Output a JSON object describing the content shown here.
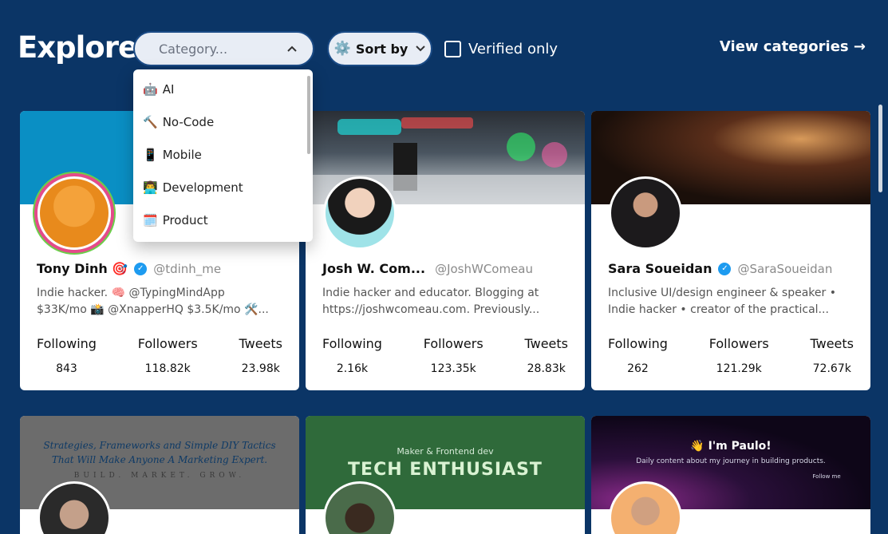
{
  "header": {
    "title": "Explore",
    "category_placeholder": "Category...",
    "sort_label": "Sort by",
    "verified_label": "Verified only",
    "view_categories": "View categories →"
  },
  "dropdown": {
    "items": [
      {
        "icon": "🤖",
        "label": "AI"
      },
      {
        "icon": "🔨",
        "label": "No-Code"
      },
      {
        "icon": "📱",
        "label": "Mobile"
      },
      {
        "icon": "👨‍💻",
        "label": "Development"
      },
      {
        "icon": "🗓️",
        "label": "Product"
      }
    ]
  },
  "cards": [
    {
      "name": "Tony Dinh 🎯",
      "handle": "@tdinh_me",
      "verified": true,
      "bio": "Indie hacker. 🧠 @TypingMindApp $33K/mo 📸 @XnapperHQ $3.5K/mo 🛠️...",
      "following_label": "Following",
      "followers_label": "Followers",
      "tweets_label": "Tweets",
      "following": "843",
      "followers": "118.82k",
      "tweets": "23.98k"
    },
    {
      "name": "Josh W. Com...",
      "handle": "@JoshWComeau",
      "verified": false,
      "bio": "Indie hacker and educator. Blogging at https://joshwcomeau.com. Previously...",
      "following_label": "Following",
      "followers_label": "Followers",
      "tweets_label": "Tweets",
      "following": "2.16k",
      "followers": "123.35k",
      "tweets": "28.83k"
    },
    {
      "name": "Sara Soueidan",
      "handle": "@SaraSoueidan",
      "verified": true,
      "bio": "Inclusive UI/design engineer & speaker • Indie hacker • creator of the practical...",
      "following_label": "Following",
      "followers_label": "Followers",
      "tweets_label": "Tweets",
      "following": "262",
      "followers": "121.29k",
      "tweets": "72.67k"
    }
  ],
  "banners": {
    "card4_line1": "Strategies, Frameworks and Simple DIY Tactics",
    "card4_line2": "That Will Make Anyone A Marketing Expert.",
    "card4_line3": "BUILD. MARKET. GROW.",
    "card5_sub": "Maker & Frontend dev",
    "card5_title": "TECH ENTHUSIAST",
    "card6_title": "👋 I'm Paulo!",
    "card6_sub": "Daily content about my journey in building products.",
    "card6_follow": "Follow me"
  },
  "colors": {
    "background": "#0b3566",
    "verified_blue": "#1d9bf0"
  }
}
